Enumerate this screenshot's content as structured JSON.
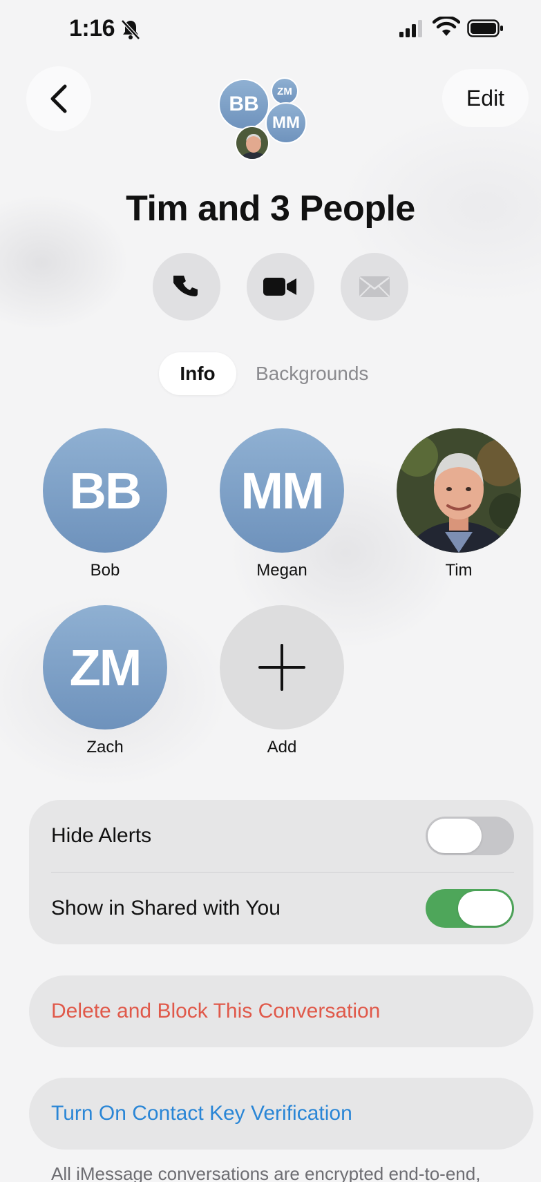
{
  "status_bar": {
    "time": "1:16",
    "icons": [
      "bell-slash-icon",
      "signal-icon",
      "wifi-icon",
      "battery-icon"
    ]
  },
  "nav": {
    "back_icon": "chevron-left-icon",
    "edit_label": "Edit"
  },
  "header_avatars": [
    {
      "initials": "BB"
    },
    {
      "initials": "ZM"
    },
    {
      "initials": "MM"
    },
    {
      "photo": "tim-photo"
    }
  ],
  "conversation_title": "Tim and 3 People",
  "actions": [
    {
      "icon": "phone-icon",
      "enabled": true
    },
    {
      "icon": "video-icon",
      "enabled": true
    },
    {
      "icon": "mail-icon",
      "enabled": false
    }
  ],
  "tabs": [
    {
      "label": "Info",
      "selected": true
    },
    {
      "label": "Backgrounds",
      "selected": false
    }
  ],
  "members": [
    {
      "initials": "BB",
      "name": "Bob"
    },
    {
      "initials": "MM",
      "name": "Megan"
    },
    {
      "photo": "tim-photo",
      "name": "Tim"
    },
    {
      "initials": "ZM",
      "name": "Zach"
    }
  ],
  "add_member": {
    "icon": "plus-icon",
    "label": "Add"
  },
  "settings": [
    {
      "label": "Hide Alerts",
      "on": false
    },
    {
      "label": "Show in Shared with You",
      "on": true
    }
  ],
  "delete_label": "Delete and Block This Conversation",
  "verification_label": "Turn On Contact Key Verification",
  "footer_note": "All iMessage conversations are encrypted end-to-end,",
  "colors": {
    "avatar_blue": "#7fa2c8",
    "toggle_on": "#4ea65a",
    "destructive": "#e0594a",
    "link_blue": "#2a86d6"
  }
}
